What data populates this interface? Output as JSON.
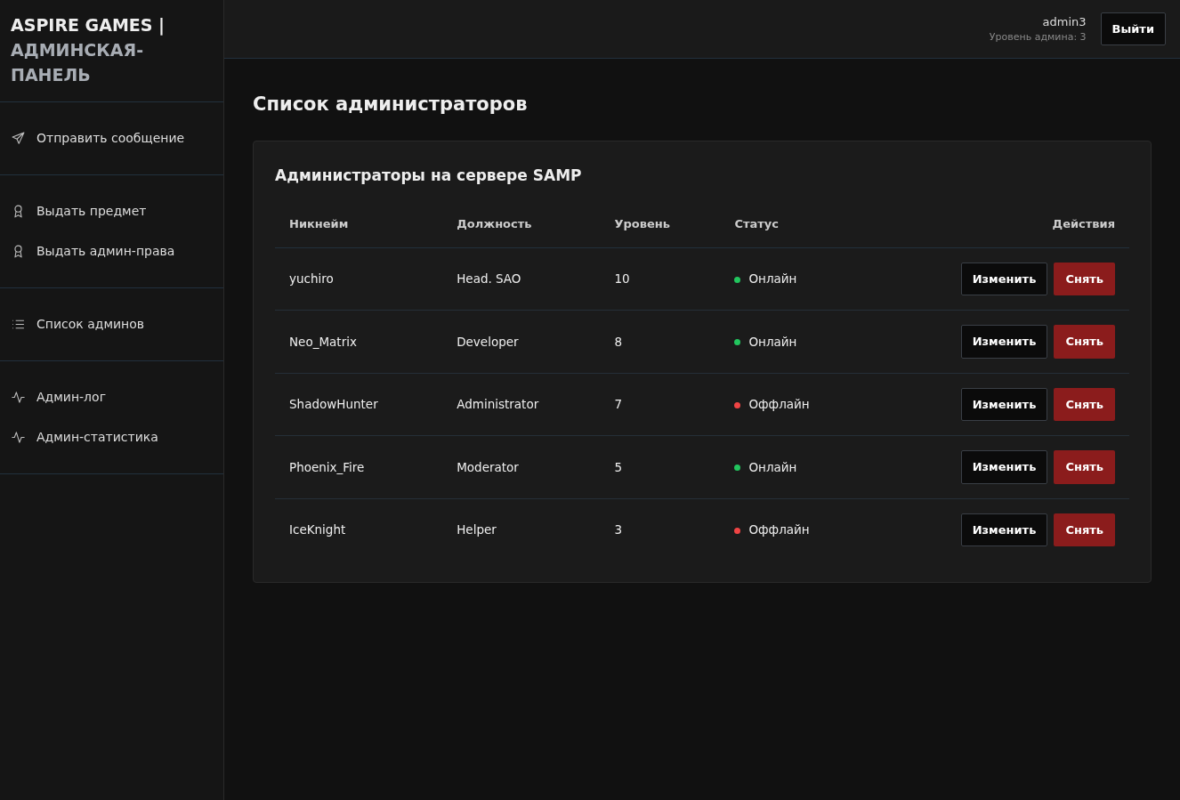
{
  "brand": {
    "title": "ASPIRE GAMES |",
    "subtitle": "АДМИНСКАЯ-ПАНЕЛЬ"
  },
  "sidebar": {
    "sections": [
      {
        "items": [
          {
            "label": "Отправить сообщение",
            "selected": false
          }
        ]
      },
      {
        "items": [
          {
            "label": "Выдать предмет",
            "selected": false
          },
          {
            "label": "Выдать админ-права",
            "selected": false
          }
        ]
      },
      {
        "items": [
          {
            "label": "Список админов",
            "selected": false
          }
        ]
      },
      {
        "items": [
          {
            "label": "Админ-лог",
            "selected": false
          },
          {
            "label": "Админ-статистика",
            "selected": false
          }
        ]
      }
    ]
  },
  "header": {
    "user": "admin3",
    "level": "Уровень админа: 3",
    "logout": "Выйти"
  },
  "page_title": "Список администраторов",
  "card": {
    "title": "Администраторы на сервере SAMP",
    "table": {
      "columns": [
        "Никнейм",
        "Должность",
        "Уровень",
        "Статус",
        "Действия"
      ],
      "rows": [
        {
          "nickname": "yuchiro",
          "position": "Head. SAO",
          "level": "10",
          "status": "Онлайн",
          "color": "#22c55e",
          "edit": "Изменить",
          "remove": "Снять"
        },
        {
          "nickname": "Neo_Matrix",
          "position": "Developer",
          "level": "8",
          "status": "Онлайн",
          "color": "#22c55e",
          "edit": "Изменить",
          "remove": "Снять"
        },
        {
          "nickname": "ShadowHunter",
          "position": "Administrator",
          "level": "7",
          "status": "Оффлайн",
          "color": "#ef4444",
          "edit": "Изменить",
          "remove": "Снять"
        },
        {
          "nickname": "Phoenix_Fire",
          "position": "Moderator",
          "level": "5",
          "status": "Онлайн",
          "color": "#22c55e",
          "edit": "Изменить",
          "remove": "Снять"
        },
        {
          "nickname": "IceKnight",
          "position": "Helper",
          "level": "3",
          "status": "Оффлайн",
          "color": "#ef4444",
          "edit": "Изменить",
          "remove": "Снять"
        }
      ]
    }
  }
}
